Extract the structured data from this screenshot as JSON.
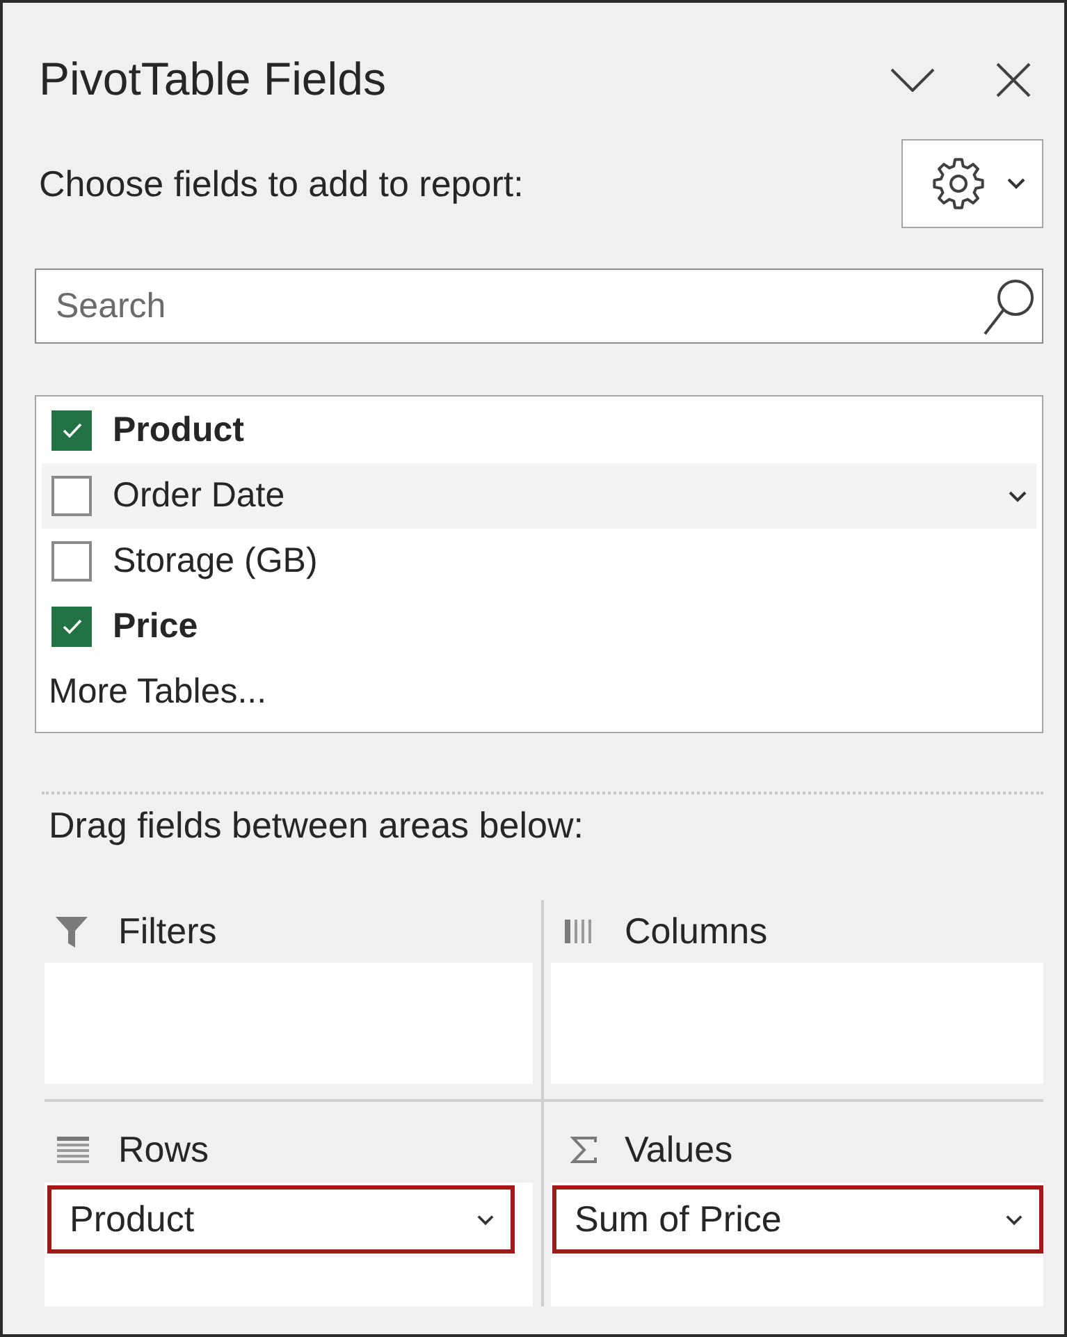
{
  "panel": {
    "title": "PivotTable Fields",
    "instruction": "Choose fields to add to report:"
  },
  "search": {
    "placeholder": "Search"
  },
  "fields": [
    {
      "label": "Product",
      "checked": true,
      "hovered": false
    },
    {
      "label": "Order Date",
      "checked": false,
      "hovered": true
    },
    {
      "label": "Storage (GB)",
      "checked": false,
      "hovered": false
    },
    {
      "label": "Price",
      "checked": true,
      "hovered": false
    }
  ],
  "more_tables": "More Tables...",
  "areas_hint": "Drag fields between areas below:",
  "areas": [
    {
      "kind": "filters",
      "label": "Filters"
    },
    {
      "kind": "columns",
      "label": "Columns"
    },
    {
      "kind": "rows",
      "label": "Rows",
      "items": [
        {
          "label": "Product",
          "highlighted": true
        }
      ]
    },
    {
      "kind": "values",
      "label": "Values",
      "items": [
        {
          "label": "Sum of Price",
          "highlighted": true
        }
      ]
    }
  ]
}
